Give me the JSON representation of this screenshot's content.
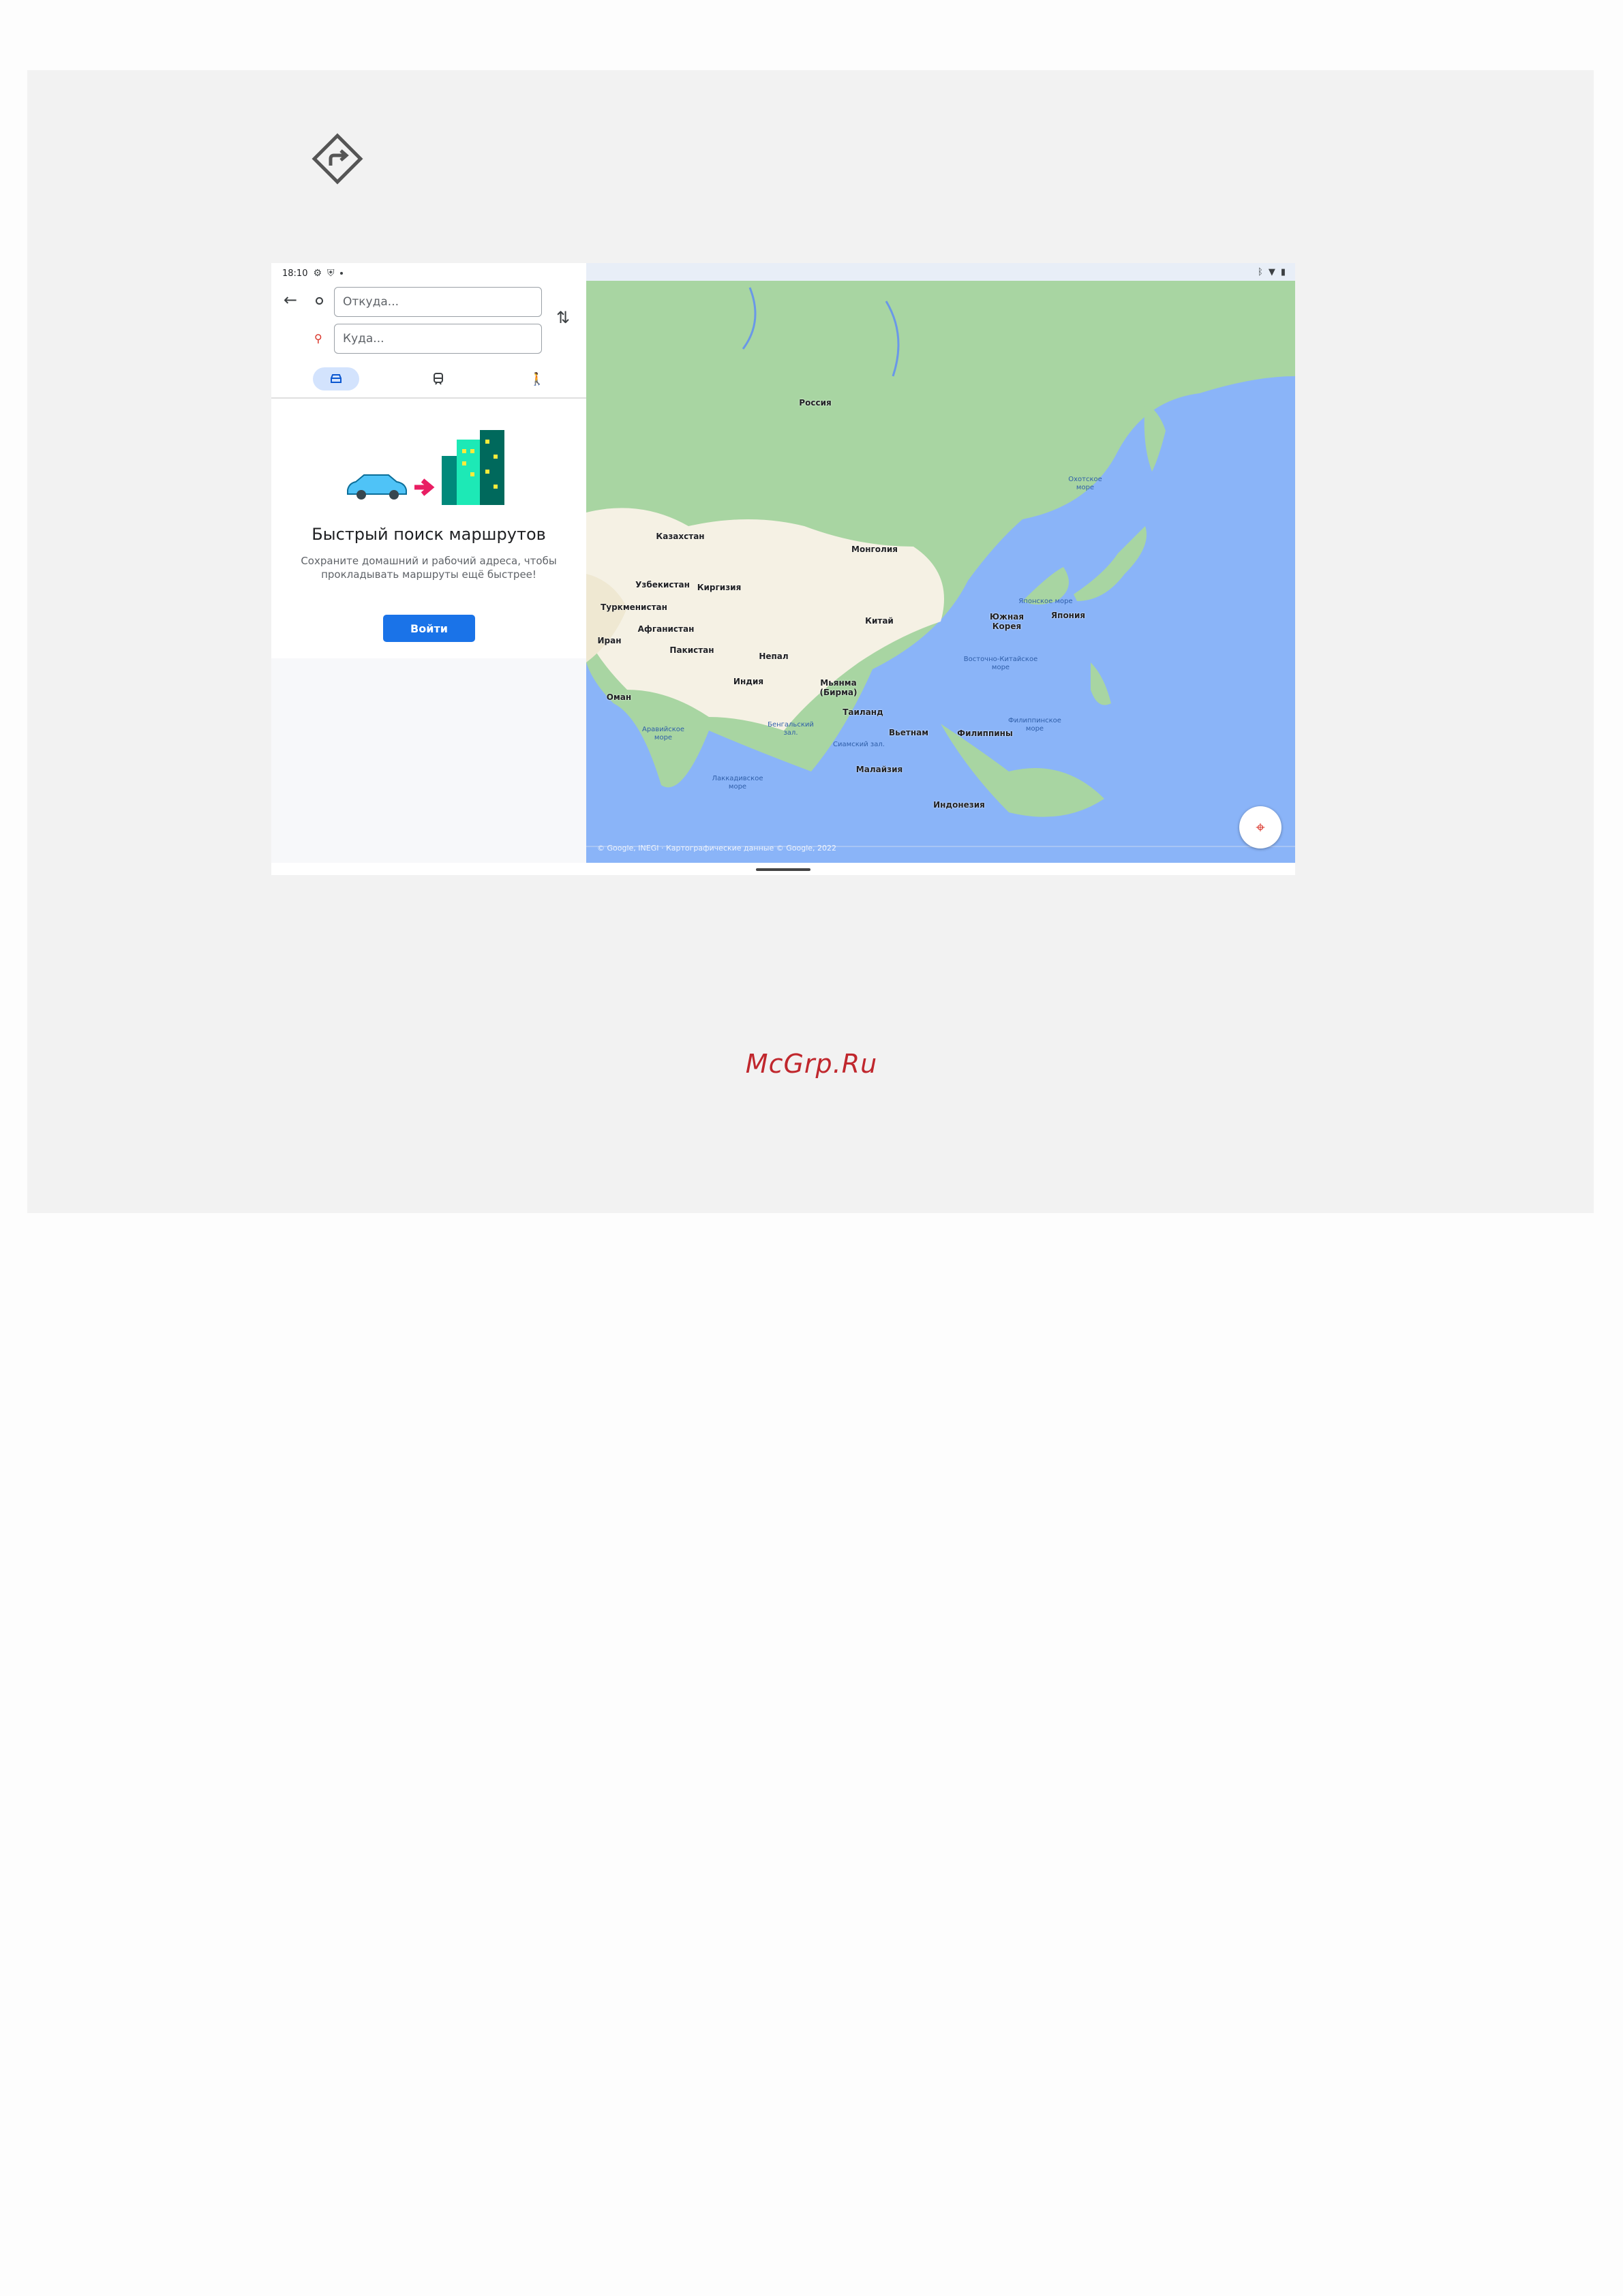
{
  "document": {
    "section_icon": "directions-sign-icon",
    "watermark": "McGrp.Ru"
  },
  "status_bar": {
    "time": "18:10",
    "left_icons": [
      "gear-icon",
      "shield-icon",
      "dot-icon"
    ],
    "right_icons": [
      "bluetooth-icon",
      "wifi-icon",
      "battery-icon"
    ]
  },
  "directions": {
    "from_placeholder": "Откуда...",
    "to_placeholder": "Куда...",
    "modes": [
      {
        "name": "car",
        "icon": "car-icon",
        "selected": true
      },
      {
        "name": "transit",
        "icon": "train-icon",
        "selected": false
      },
      {
        "name": "walk",
        "icon": "walk-icon",
        "selected": false
      }
    ]
  },
  "promo": {
    "title": "Быстрый поиск маршрутов",
    "body": "Сохраните домашний и рабочий адреса, чтобы прокладывать маршруты ещё быстрее!",
    "login_button": "Войти"
  },
  "map": {
    "countries": {
      "russia": "Россия",
      "kazakhstan": "Казахстан",
      "mongolia": "Монголия",
      "uzbekistan": "Узбекистан",
      "kyrgyzstan": "Киргизия",
      "turkmenistan": "Туркменистан",
      "afghanistan": "Афганистан",
      "iran": "Иран",
      "pakistan": "Пакистан",
      "nepal": "Непал",
      "china": "Китай",
      "south_korea": "Южная Корея",
      "japan": "Япония",
      "india": "Индия",
      "oman": "Оман",
      "myanmar": "Мьянма (Бирма)",
      "thailand": "Таиланд",
      "vietnam": "Вьетнам",
      "philippines": "Филиппины",
      "malaysia": "Малайзия",
      "indonesia": "Индонезия"
    },
    "seas": {
      "okhotsk": "Охотское море",
      "japan_sea": "Японское море",
      "east_china_sea": "Восточно-Китайское море",
      "philippine_sea": "Филиппинское море",
      "arabian_sea": "Аравийское море",
      "bengal_bay": "Бенгальский зал.",
      "siam_bay": "Сиамский зал.",
      "laccadive_sea": "Лаккадивское море"
    },
    "attribution": "© Google, INEGI · Картографические данные © Google, 2022",
    "colors": {
      "water": "#8ab4f8",
      "forest": "#a8d5a2",
      "land": "#f5f1e4",
      "accent": "#1a73e8"
    }
  }
}
